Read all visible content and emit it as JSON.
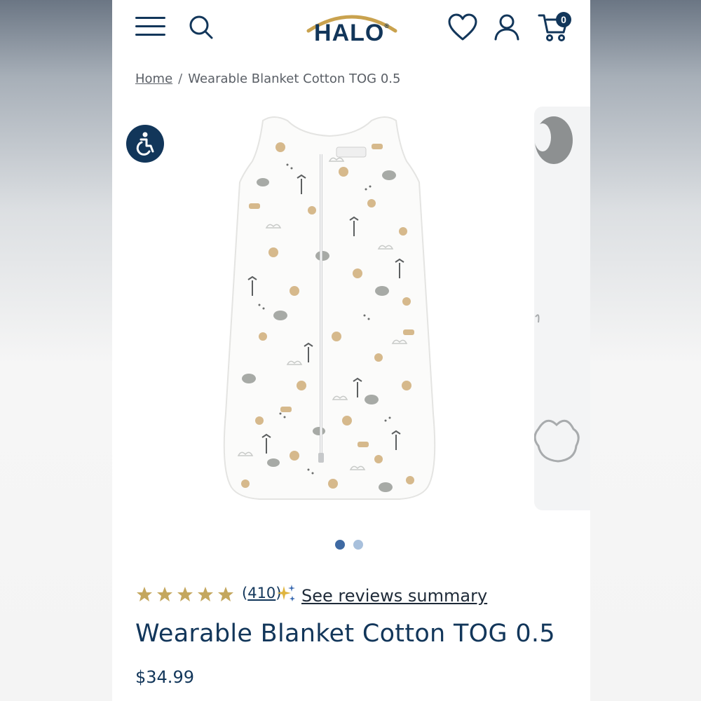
{
  "header": {
    "logo_text": "HALO",
    "logo_mark": "®",
    "cart_count": "0",
    "icons": [
      "menu-icon",
      "search-icon",
      "heart-icon",
      "account-icon",
      "cart-icon"
    ]
  },
  "breadcrumb": {
    "home": "Home",
    "separator": "/",
    "current": "Wearable Blanket Cotton TOG 0.5"
  },
  "gallery": {
    "slide_count": 2,
    "active_slide": 1
  },
  "reviews": {
    "rating": 5,
    "count_open": "(",
    "count": "410",
    "count_close": ")",
    "summary_link": "See reviews summary"
  },
  "product": {
    "title": "Wearable Blanket Cotton TOG 0.5",
    "price": "$34.99"
  },
  "colors": {
    "brand_navy": "#12365a",
    "logo_gold": "#c9a24e",
    "star_gold": "#c4a75e",
    "dot_active": "#3f6aa3",
    "dot_inactive": "#a8c0dc"
  }
}
